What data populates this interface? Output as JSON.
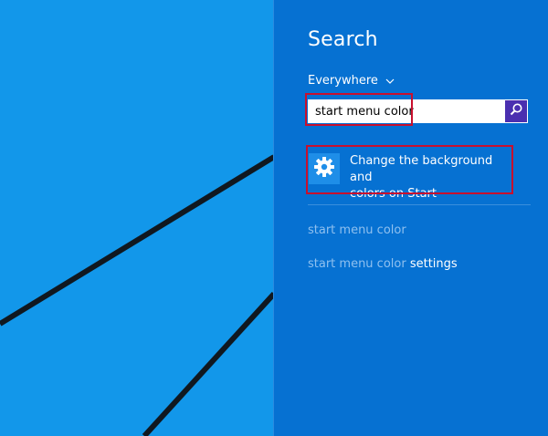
{
  "charm": {
    "title": "Search",
    "scope_label": "Everywhere",
    "search": {
      "value": "start menu color",
      "placeholder": ""
    },
    "best_match": {
      "line1": "Change the background and",
      "line2": "colors on Start"
    },
    "suggestions": [
      {
        "query": "start menu color",
        "suffix": ""
      },
      {
        "query": "start menu color",
        "suffix": " settings"
      }
    ]
  },
  "colors": {
    "desktop_bg": "#1297ea",
    "charm_bg": "#0671d2",
    "search_button": "#4a2fb0",
    "highlight": "#c8102e",
    "suggestion_text": "#8fc0ef"
  },
  "icons": {
    "search_button": "search-icon",
    "scope": "chevron-down-icon",
    "best_match": "gear-icon"
  }
}
